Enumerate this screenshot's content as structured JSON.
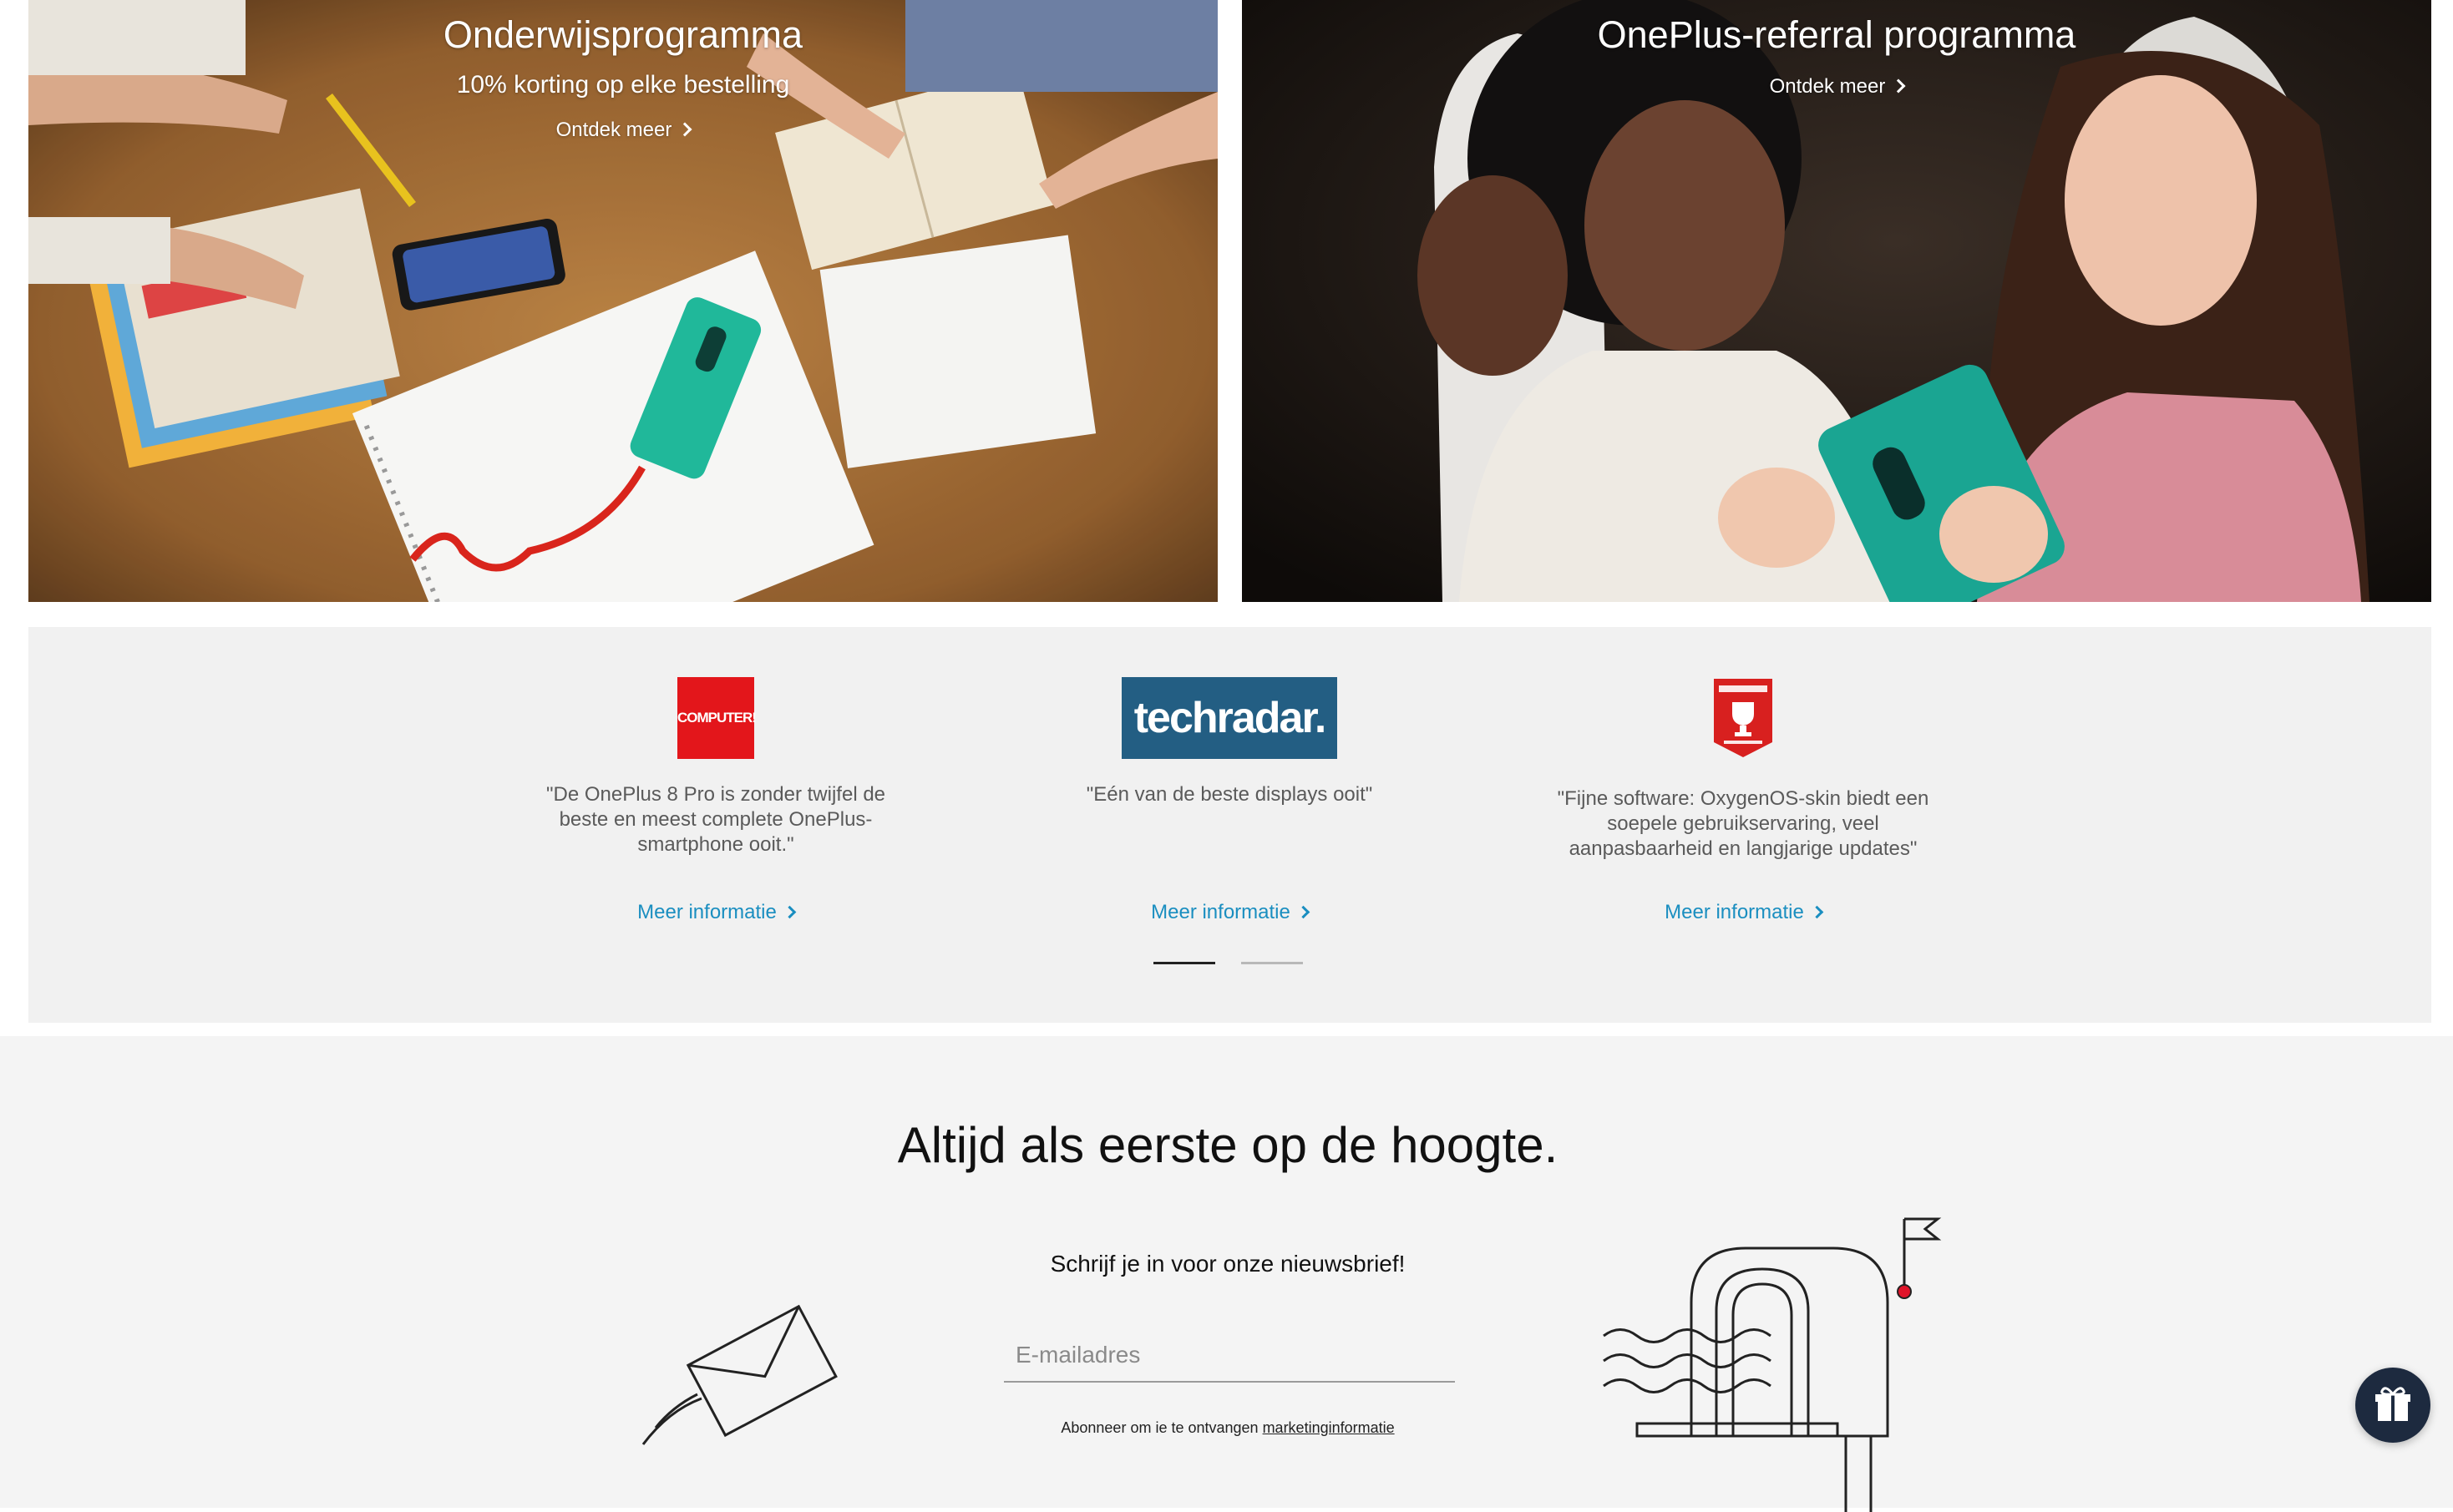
{
  "banners": [
    {
      "title": "Onderwijsprogramma",
      "subtitle": "10% korting op elke bestelling",
      "link": "Ontdek meer"
    },
    {
      "title": "OnePlus-referral programma",
      "link": "Ontdek meer"
    }
  ],
  "reviews": [
    {
      "logo": "COMPUTER!",
      "quote": "\"De OnePlus 8 Pro is zonder twijfel de beste en meest complete OnePlus-smartphone ooit.\"",
      "link": "Meer informatie"
    },
    {
      "logo": "techradar.",
      "quote": "\"Eén van de beste displays ooit\"",
      "link": "Meer informatie"
    },
    {
      "logo": "Hardware Info",
      "quote": "\"Fijne software: OxygenOS-skin biedt een soepele gebruikservaring, veel aanpasbaarheid en langjarige updates\"",
      "link": "Meer informatie"
    }
  ],
  "slider": {
    "page_count": 2,
    "active_index": 0
  },
  "newsletter": {
    "title": "Altijd als eerste op de hoogte.",
    "subtitle": "Schrijf je in voor onze nieuwsbrief!",
    "email_placeholder": "E-mailadres",
    "consent_prefix": "Abonneer om ie te ontvangen",
    "consent_link": "marketinginformatie"
  },
  "icons": {
    "link_chevron": "chevron-right-icon",
    "envelope": "envelope-icon",
    "mailbox": "mailbox-icon",
    "gift": "gift-icon"
  },
  "colors": {
    "link_blue": "#1a8ec0",
    "reviews_bg": "#f1f1f1",
    "newsletter_bg": "#f4f4f4",
    "gift_button": "#1d2a3f",
    "mailbox_flag_dot": "#e0142a"
  }
}
